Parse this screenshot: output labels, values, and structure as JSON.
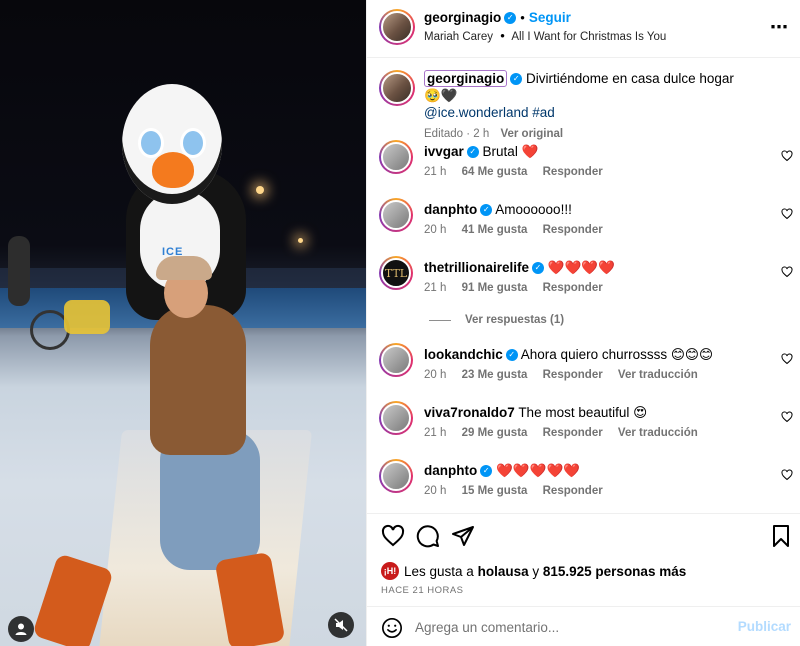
{
  "post": {
    "author": "georginagio",
    "follow_label": "Seguir",
    "song_artist": "Mariah Carey",
    "song_separator": "•",
    "song_title": "All I Want for Christmas Is You",
    "more_icon": "more-horizontal-icon"
  },
  "caption": {
    "username": "georginagio",
    "text": "Divirtiéndome en casa dulce hogar 🥹🖤",
    "mention": "@ice.wonderland",
    "hashtag": "#ad",
    "edited": "Editado",
    "time": "2 h",
    "see_original": "Ver original"
  },
  "comments": [
    {
      "user": "ivvgar",
      "verified": true,
      "text": "Brutal ❤️",
      "time": "21 h",
      "likes": "64 Me gusta",
      "reply": "Responder",
      "translate": ""
    },
    {
      "user": "danphto",
      "verified": true,
      "text": "Amoooooo!!!",
      "time": "20 h",
      "likes": "41 Me gusta",
      "reply": "Responder",
      "translate": ""
    },
    {
      "user": "thetrillionairelife",
      "verified": true,
      "text": "❤️❤️❤️❤️",
      "time": "21 h",
      "likes": "91 Me gusta",
      "reply": "Responder",
      "translate": ""
    },
    {
      "user": "lookandchic",
      "verified": true,
      "text": "Ahora quiero churrossss 😊😊😊",
      "time": "20 h",
      "likes": "23 Me gusta",
      "reply": "Responder",
      "translate": "Ver traducción"
    },
    {
      "user": "viva7ronaldo7",
      "verified": false,
      "text": "The most beautiful 😍",
      "time": "21 h",
      "likes": "29 Me gusta",
      "reply": "Responder",
      "translate": "Ver traducción"
    },
    {
      "user": "danphto",
      "verified": true,
      "text": "❤️❤️❤️❤️❤️",
      "time": "20 h",
      "likes": "15 Me gusta",
      "reply": "Responder",
      "translate": ""
    }
  ],
  "view_replies": "Ver respuestas (1)",
  "likes": {
    "prefix": "Les gusta a",
    "user": "holausa",
    "connector": "y",
    "others": "815.925 personas más"
  },
  "time_ago": "HACE 21 HORAS",
  "composer": {
    "placeholder": "Agrega un comentario...",
    "post_label": "Publicar"
  },
  "trillionaire_avatar_text": "TTL",
  "colors": {
    "accent": "#0095f6",
    "muted": "#737373",
    "post_disabled": "#b3dbff",
    "heart": "#ed4956"
  }
}
